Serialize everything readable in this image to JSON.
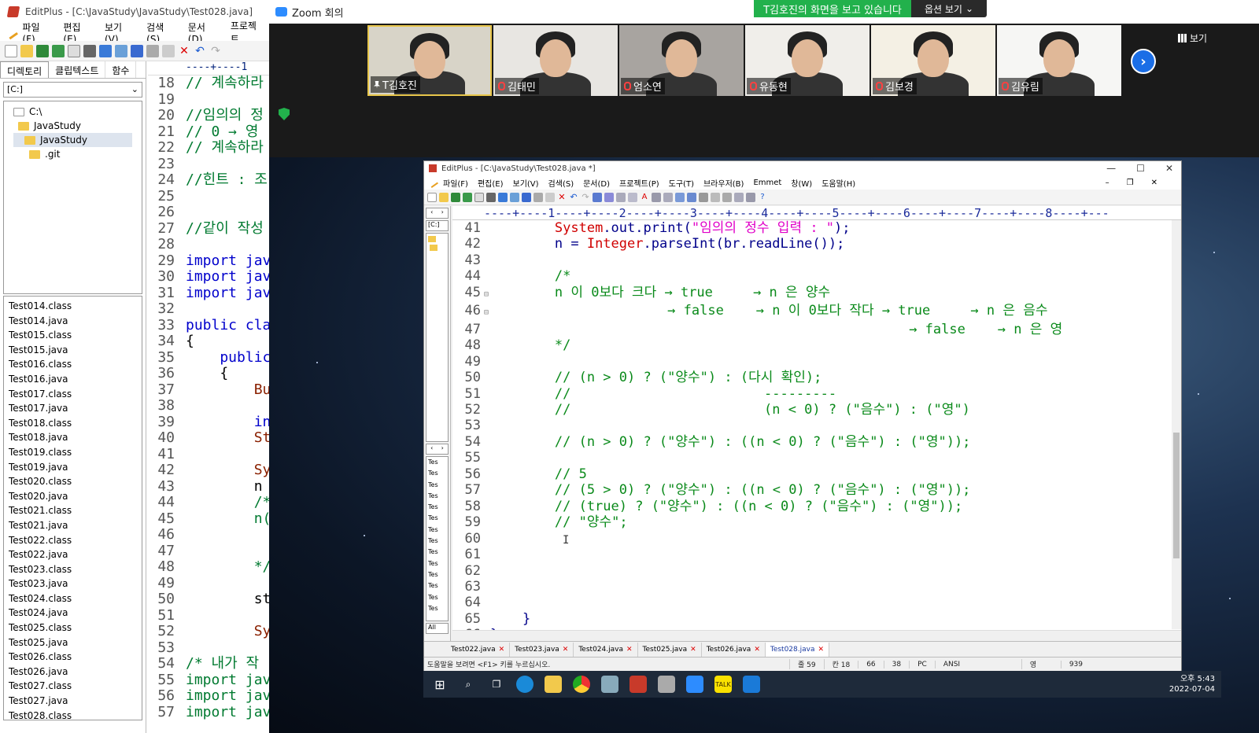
{
  "bg_editplus": {
    "title": "EditPlus - [C:\\JavaStudy\\JavaStudy\\Test028.java]",
    "menu": [
      "파일(F)",
      "편집(E)",
      "보기(V)",
      "검색(S)",
      "문서(D)",
      "프로젝트"
    ],
    "panel_tabs": [
      "디렉토리",
      "클립텍스트",
      "함수"
    ],
    "drive": "[C:]",
    "tree": [
      "C:\\",
      "JavaStudy",
      "JavaStudy",
      ".git"
    ],
    "files": [
      "Test014.class",
      "Test014.java",
      "Test015.class",
      "Test015.java",
      "Test016.class",
      "Test016.java",
      "Test017.class",
      "Test017.java",
      "Test018.class",
      "Test018.java",
      "Test019.class",
      "Test019.java",
      "Test020.class",
      "Test020.java",
      "Test021.class",
      "Test021.java",
      "Test022.class",
      "Test022.java",
      "Test023.class",
      "Test023.java",
      "Test024.class",
      "Test024.java",
      "Test025.class",
      "Test025.java",
      "Test026.class",
      "Test026.java",
      "Test027.class",
      "Test027.java",
      "Test028.class"
    ],
    "ruler": "----+----1",
    "code_lines": [
      {
        "n": "18",
        "t": "// 계속하라",
        "c": "cm"
      },
      {
        "n": "19",
        "t": "",
        "c": "plain"
      },
      {
        "n": "20",
        "t": "//임의의 정",
        "c": "cm"
      },
      {
        "n": "21",
        "t": "// 0 → 영",
        "c": "cm"
      },
      {
        "n": "22",
        "t": "// 계속하라",
        "c": "cm"
      },
      {
        "n": "23",
        "t": "",
        "c": "plain"
      },
      {
        "n": "24",
        "t": "//힌트 : 조",
        "c": "cm"
      },
      {
        "n": "25",
        "t": "",
        "c": "plain"
      },
      {
        "n": "26",
        "t": "",
        "c": "plain"
      },
      {
        "n": "27",
        "t": "//같이 작성",
        "c": "cm"
      },
      {
        "n": "28",
        "t": "",
        "c": "plain"
      },
      {
        "n": "29",
        "t": "import jav",
        "c": "kw"
      },
      {
        "n": "30",
        "t": "import jav",
        "c": "kw"
      },
      {
        "n": "31",
        "t": "import jav",
        "c": "kw"
      },
      {
        "n": "32",
        "t": "",
        "c": "plain"
      },
      {
        "n": "33",
        "t": "public cla",
        "c": "kw"
      },
      {
        "n": "34",
        "t": "{",
        "c": "plain"
      },
      {
        "n": "35",
        "t": "    public",
        "c": "kw"
      },
      {
        "n": "36",
        "t": "    {",
        "c": "plain"
      },
      {
        "n": "37",
        "t": "        Bu",
        "c": "brw"
      },
      {
        "n": "38",
        "t": "",
        "c": "plain"
      },
      {
        "n": "39",
        "t": "        in",
        "c": "kw"
      },
      {
        "n": "40",
        "t": "        St",
        "c": "brw"
      },
      {
        "n": "41",
        "t": "",
        "c": "plain"
      },
      {
        "n": "42",
        "t": "        Sy",
        "c": "brw"
      },
      {
        "n": "43",
        "t": "        n ",
        "c": "plain"
      },
      {
        "n": "44",
        "t": "        /*",
        "c": "cm"
      },
      {
        "n": "45",
        "t": "        n(",
        "c": "cm"
      },
      {
        "n": "46",
        "t": "",
        "c": "plain"
      },
      {
        "n": "47",
        "t": "",
        "c": "plain"
      },
      {
        "n": "48",
        "t": "        */",
        "c": "cm"
      },
      {
        "n": "49",
        "t": "",
        "c": "plain"
      },
      {
        "n": "50",
        "t": "        st",
        "c": "plain"
      },
      {
        "n": "51",
        "t": "",
        "c": "plain"
      },
      {
        "n": "52",
        "t": "        Sy",
        "c": "brw"
      },
      {
        "n": "53",
        "t": "",
        "c": "plain"
      },
      {
        "n": "54",
        "t": "/* 내가 작",
        "c": "cm"
      },
      {
        "n": "55",
        "t": "import jav",
        "c": "cm"
      },
      {
        "n": "56",
        "t": "import jav",
        "c": "cm"
      },
      {
        "n": "57",
        "t": "import jav",
        "c": "cm"
      }
    ]
  },
  "zoom": {
    "title": "Zoom 회의",
    "share_banner": "T김호진의 화면을 보고 있습니다",
    "view_options": "옵션 보기",
    "view_button": "보기",
    "participants": [
      {
        "name": "T김호진",
        "muted": false,
        "pinned": true,
        "bg": "#d8d4c8"
      },
      {
        "name": "김태민",
        "muted": true,
        "pinned": false,
        "bg": "#e8e6e2"
      },
      {
        "name": "엄소연",
        "muted": true,
        "pinned": false,
        "bg": "#a8a4a0"
      },
      {
        "name": "유동현",
        "muted": true,
        "pinned": false,
        "bg": "#f0eeea"
      },
      {
        "name": "김보경",
        "muted": true,
        "pinned": false,
        "bg": "#f4f0e4"
      },
      {
        "name": "김유림",
        "muted": true,
        "pinned": false,
        "bg": "#f6f6f4"
      }
    ]
  },
  "shared_editplus": {
    "title": "EditPlus - [C:\\JavaStudy\\Test028.java *]",
    "menu": [
      "파일(F)",
      "편집(E)",
      "보기(V)",
      "검색(S)",
      "문서(D)",
      "프로젝트(P)",
      "도구(T)",
      "브라우저(B)",
      "Emmet",
      "창(W)",
      "도움말(H)"
    ],
    "ruler": "----+----1----+----2----+----3----+----4----+----5----+----6----+----7----+----8----+---",
    "drive": "[C:]",
    "left_files": [
      "Tes",
      "Tes",
      "Tes",
      "Tes",
      "Tes",
      "Tes",
      "Tes",
      "Tes",
      "Tes",
      "Tes",
      "Tes",
      "Tes",
      "Tes",
      "Tes"
    ],
    "all_label": "All",
    "code": [
      {
        "n": "41",
        "fold": "",
        "segs": [
          {
            "t": "        ",
            "c": ""
          },
          {
            "t": "System",
            "c": "r"
          },
          {
            "t": ".out.print(",
            "c": "b"
          },
          {
            "t": "\"임의의 정수 입력 : \"",
            "c": "m"
          },
          {
            "t": ");",
            "c": "b"
          }
        ]
      },
      {
        "n": "42",
        "fold": "",
        "segs": [
          {
            "t": "        n = ",
            "c": "b"
          },
          {
            "t": "Integer",
            "c": "r"
          },
          {
            "t": ".parseInt(br.readLine());",
            "c": "b"
          }
        ]
      },
      {
        "n": "43",
        "fold": "",
        "segs": []
      },
      {
        "n": "44",
        "fold": "",
        "segs": [
          {
            "t": "        /*",
            "c": "g"
          }
        ]
      },
      {
        "n": "45",
        "fold": "⊟",
        "segs": [
          {
            "t": "        n 이 0보다 크다 → true     → n 은 양수",
            "c": "g"
          }
        ]
      },
      {
        "n": "46",
        "fold": "⊟",
        "segs": [
          {
            "t": "                      → false    → n 이 0보다 작다 → true     → n 은 음수",
            "c": "g"
          }
        ]
      },
      {
        "n": "47",
        "fold": "",
        "segs": [
          {
            "t": "                                                    → false    → n 은 영",
            "c": "g"
          }
        ]
      },
      {
        "n": "48",
        "fold": "",
        "segs": [
          {
            "t": "        */",
            "c": "g"
          }
        ]
      },
      {
        "n": "49",
        "fold": "",
        "segs": []
      },
      {
        "n": "50",
        "fold": "",
        "segs": [
          {
            "t": "        // (n > 0) ? (\"양수\") : (다시 확인);",
            "c": "g"
          }
        ]
      },
      {
        "n": "51",
        "fold": "",
        "segs": [
          {
            "t": "        //                        ---------",
            "c": "g"
          }
        ]
      },
      {
        "n": "52",
        "fold": "",
        "segs": [
          {
            "t": "        //                        (n < 0) ? (\"음수\") : (\"영\")",
            "c": "g"
          }
        ]
      },
      {
        "n": "53",
        "fold": "",
        "segs": []
      },
      {
        "n": "54",
        "fold": "",
        "segs": [
          {
            "t": "        // (n > 0) ? (\"양수\") : ((n < 0) ? (\"음수\") : (\"영\"));",
            "c": "g"
          }
        ]
      },
      {
        "n": "55",
        "fold": "",
        "segs": []
      },
      {
        "n": "56",
        "fold": "",
        "segs": [
          {
            "t": "        // 5",
            "c": "g"
          }
        ]
      },
      {
        "n": "57",
        "fold": "",
        "segs": [
          {
            "t": "        // (5 > 0) ? (\"양수\") : ((n < 0) ? (\"음수\") : (\"영\"));",
            "c": "g"
          }
        ]
      },
      {
        "n": "58",
        "fold": "",
        "segs": [
          {
            "t": "        // (true) ? (\"양수\") : ((n < 0) ? (\"음수\") : (\"영\"));",
            "c": "g"
          }
        ]
      },
      {
        "n": "59",
        "fold": "",
        "segs": [
          {
            "t": "        // \"양수\";",
            "c": "g"
          }
        ]
      },
      {
        "n": "60",
        "fold": "",
        "segs": []
      },
      {
        "n": "61",
        "fold": "",
        "segs": []
      },
      {
        "n": "62",
        "fold": "",
        "segs": []
      },
      {
        "n": "63",
        "fold": "",
        "segs": []
      },
      {
        "n": "64",
        "fold": "",
        "segs": []
      },
      {
        "n": "65",
        "fold": "",
        "segs": [
          {
            "t": "    }",
            "c": "b"
          }
        ]
      },
      {
        "n": "66",
        "fold": "",
        "segs": [
          {
            "t": "}",
            "c": "b"
          }
        ]
      }
    ],
    "file_tabs": [
      "Test022.java",
      "Test023.java",
      "Test024.java",
      "Test025.java",
      "Test026.java",
      "Test028.java"
    ],
    "active_tab": "Test028.java",
    "status": {
      "hint": "도움말을 보려면 <F1> 키를 누르십시오.",
      "line": "줄 59",
      "col": "칸 18",
      "v1": "66",
      "v2": "38",
      "mode": "PC",
      "enc": "ANSI",
      "lang": "영",
      "size": "939"
    }
  },
  "taskbar": {
    "time": "오후 5:43",
    "date": "2022-07-04"
  }
}
